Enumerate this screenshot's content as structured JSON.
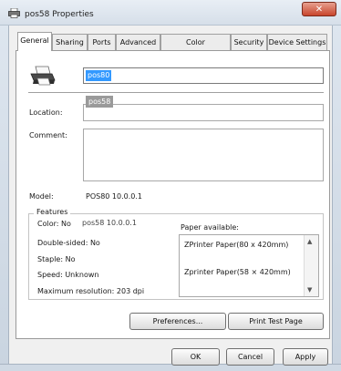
{
  "window": {
    "title": "pos58 Properties",
    "close_glyph": "✕"
  },
  "tabs": [
    "General",
    "Sharing",
    "Ports",
    "Advanced",
    "Color Management",
    "Security",
    "Device Settings"
  ],
  "general": {
    "printer_name": "pos80",
    "tooltip": "pos58",
    "location_label": "Location:",
    "comment_label": "Comment:",
    "model_label": "Model:",
    "model_value": "POS80 10.0.0.1",
    "features_title": "Features",
    "color": "Color: No",
    "color_overlay": "pos58 10.0.0.1",
    "double_sided": "Double-sided: No",
    "staple": "Staple: No",
    "speed": "Speed: Unknown",
    "max_resolution": "Maximum resolution: 203 dpi",
    "paper_available_label": "Paper available:",
    "paper_available": [
      "ZPrinter Paper(80 x 420mm)",
      "Zprinter Paper(58 × 420mm)"
    ]
  },
  "buttons": {
    "preferences": "Preferences...",
    "print_test_page": "Print Test Page",
    "ok": "OK",
    "cancel": "Cancel",
    "apply": "Apply"
  },
  "icons": {
    "window": "printer-icon",
    "printer": "printer-icon",
    "close": "close-icon",
    "scroll_up": "scroll-up-arrow-icon",
    "scroll_down": "scroll-down-arrow-icon"
  },
  "colors": {
    "selection": "#3399ff",
    "close_button": "#c8452c",
    "tooltip_bg": "#9a9a9a"
  }
}
